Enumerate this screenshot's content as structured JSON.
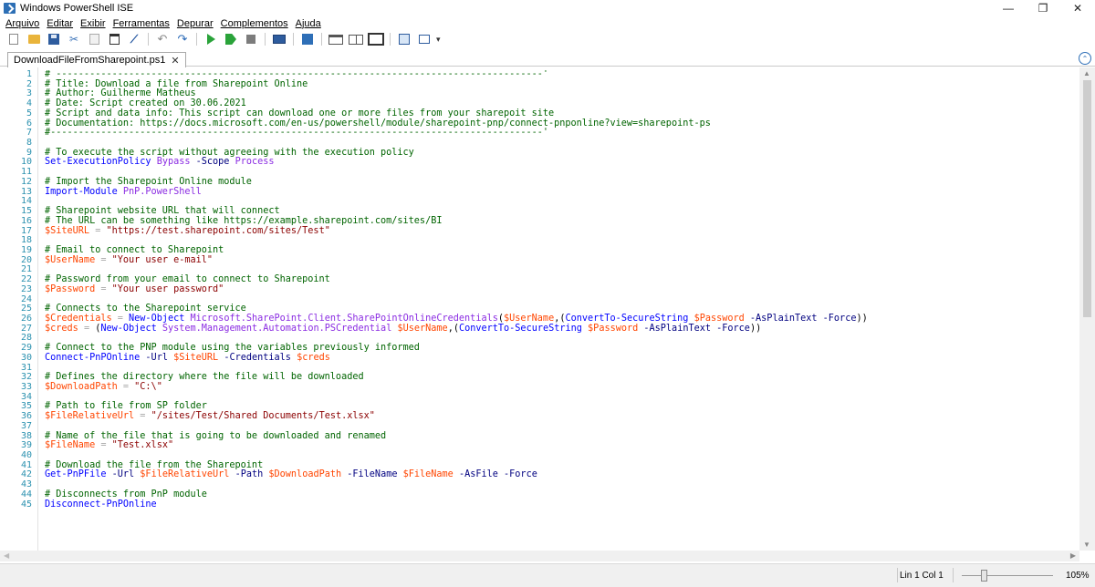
{
  "window": {
    "title": "Windows PowerShell ISE"
  },
  "menu": [
    "Arquivo",
    "Editar",
    "Exibir",
    "Ferramentas",
    "Depurar",
    "Complementos",
    "Ajuda"
  ],
  "tab": {
    "label": "DownloadFileFromSharepoint.ps1"
  },
  "editor": {
    "lines": [
      [
        [
          "c-comment",
          "# ---------------------------------------------------------------------------------------'"
        ]
      ],
      [
        [
          "c-comment",
          "# Title: Download a file from Sharepoint Online"
        ]
      ],
      [
        [
          "c-comment",
          "# Author: Guilherme Matheus"
        ]
      ],
      [
        [
          "c-comment",
          "# Date: Script created on 30.06.2021"
        ]
      ],
      [
        [
          "c-comment",
          "# Script and data info: This script can download one or more files from your sharepoit site"
        ]
      ],
      [
        [
          "c-comment",
          "# Documentation: https://docs.microsoft.com/en-us/powershell/module/sharepoint-pnp/connect-pnponline?view=sharepoint-ps"
        ]
      ],
      [
        [
          "c-comment",
          "#----------------------------------------------------------------------------------------'"
        ]
      ],
      [],
      [
        [
          "c-comment",
          "# To execute the script without agreeing with the execution policy"
        ]
      ],
      [
        [
          "c-cmd",
          "Set-ExecutionPolicy"
        ],
        [
          "c-grp",
          " "
        ],
        [
          "c-arg",
          "Bypass"
        ],
        [
          "c-grp",
          " "
        ],
        [
          "c-param",
          "-Scope"
        ],
        [
          "c-grp",
          " "
        ],
        [
          "c-arg",
          "Process"
        ]
      ],
      [],
      [
        [
          "c-comment",
          "# Import the Sharepoint Online module"
        ]
      ],
      [
        [
          "c-cmd",
          "Import-Module"
        ],
        [
          "c-grp",
          " "
        ],
        [
          "c-arg",
          "PnP.PowerShell"
        ]
      ],
      [],
      [
        [
          "c-comment",
          "# Sharepoint website URL that will connect"
        ]
      ],
      [
        [
          "c-comment",
          "# The URL can be something like https://example.sharepoint.com/sites/BI"
        ]
      ],
      [
        [
          "c-var",
          "$SiteURL"
        ],
        [
          "c-grp",
          " "
        ],
        [
          "c-op",
          "="
        ],
        [
          "c-grp",
          " "
        ],
        [
          "c-str",
          "\"https://test.sharepoint.com/sites/Test\""
        ]
      ],
      [],
      [
        [
          "c-comment",
          "# Email to connect to Sharepoint"
        ]
      ],
      [
        [
          "c-var",
          "$UserName"
        ],
        [
          "c-grp",
          " "
        ],
        [
          "c-op",
          "="
        ],
        [
          "c-grp",
          " "
        ],
        [
          "c-str",
          "\"Your user e-mail\""
        ]
      ],
      [],
      [
        [
          "c-comment",
          "# Password from your email to connect to Sharepoint"
        ]
      ],
      [
        [
          "c-var",
          "$Password"
        ],
        [
          "c-grp",
          " "
        ],
        [
          "c-op",
          "="
        ],
        [
          "c-grp",
          " "
        ],
        [
          "c-str",
          "\"Your user password\""
        ]
      ],
      [],
      [
        [
          "c-comment",
          "# Connects to the Sharepoint service"
        ]
      ],
      [
        [
          "c-var",
          "$Credentials"
        ],
        [
          "c-grp",
          " "
        ],
        [
          "c-op",
          "="
        ],
        [
          "c-grp",
          " "
        ],
        [
          "c-cmd",
          "New-Object"
        ],
        [
          "c-grp",
          " "
        ],
        [
          "c-arg",
          "Microsoft.SharePoint.Client.SharePointOnlineCredentials"
        ],
        [
          "c-grp",
          "("
        ],
        [
          "c-var",
          "$UserName"
        ],
        [
          "c-grp",
          ",("
        ],
        [
          "c-cmd",
          "ConvertTo-SecureString"
        ],
        [
          "c-grp",
          " "
        ],
        [
          "c-var",
          "$Password"
        ],
        [
          "c-grp",
          " "
        ],
        [
          "c-param",
          "-AsPlainText"
        ],
        [
          "c-grp",
          " "
        ],
        [
          "c-param",
          "-Force"
        ],
        [
          "c-grp",
          "))"
        ]
      ],
      [
        [
          "c-var",
          "$creds"
        ],
        [
          "c-grp",
          " "
        ],
        [
          "c-op",
          "="
        ],
        [
          "c-grp",
          " ("
        ],
        [
          "c-cmd",
          "New-Object"
        ],
        [
          "c-grp",
          " "
        ],
        [
          "c-arg",
          "System.Management.Automation.PSCredential"
        ],
        [
          "c-grp",
          " "
        ],
        [
          "c-var",
          "$UserName"
        ],
        [
          "c-grp",
          ",("
        ],
        [
          "c-cmd",
          "ConvertTo-SecureString"
        ],
        [
          "c-grp",
          " "
        ],
        [
          "c-var",
          "$Password"
        ],
        [
          "c-grp",
          " "
        ],
        [
          "c-param",
          "-AsPlainText"
        ],
        [
          "c-grp",
          " "
        ],
        [
          "c-param",
          "-Force"
        ],
        [
          "c-grp",
          "))"
        ]
      ],
      [],
      [
        [
          "c-comment",
          "# Connect to the PNP module using the variables previously informed"
        ]
      ],
      [
        [
          "c-cmd",
          "Connect-PnPOnline"
        ],
        [
          "c-grp",
          " "
        ],
        [
          "c-param",
          "-Url"
        ],
        [
          "c-grp",
          " "
        ],
        [
          "c-var",
          "$SiteURL"
        ],
        [
          "c-grp",
          " "
        ],
        [
          "c-param",
          "-Credentials"
        ],
        [
          "c-grp",
          " "
        ],
        [
          "c-var",
          "$creds"
        ]
      ],
      [],
      [
        [
          "c-comment",
          "# Defines the directory where the file will be downloaded"
        ]
      ],
      [
        [
          "c-var",
          "$DownloadPath"
        ],
        [
          "c-grp",
          " "
        ],
        [
          "c-op",
          "="
        ],
        [
          "c-grp",
          " "
        ],
        [
          "c-str",
          "\"C:\\\""
        ]
      ],
      [],
      [
        [
          "c-comment",
          "# Path to file from SP folder"
        ]
      ],
      [
        [
          "c-var",
          "$FileRelativeUrl"
        ],
        [
          "c-grp",
          " "
        ],
        [
          "c-op",
          "="
        ],
        [
          "c-grp",
          " "
        ],
        [
          "c-str",
          "\"/sites/Test/Shared Documents/Test.xlsx\""
        ]
      ],
      [],
      [
        [
          "c-comment",
          "# Name of the file that is going to be downloaded and renamed"
        ]
      ],
      [
        [
          "c-var",
          "$FileName"
        ],
        [
          "c-grp",
          " "
        ],
        [
          "c-op",
          "="
        ],
        [
          "c-grp",
          " "
        ],
        [
          "c-str",
          "\"Test.xlsx\""
        ]
      ],
      [],
      [
        [
          "c-comment",
          "# Download the file from the Sharepoint"
        ]
      ],
      [
        [
          "c-cmd",
          "Get-PnPFile"
        ],
        [
          "c-grp",
          " "
        ],
        [
          "c-param",
          "-Url"
        ],
        [
          "c-grp",
          " "
        ],
        [
          "c-var",
          "$FileRelativeUrl"
        ],
        [
          "c-grp",
          " "
        ],
        [
          "c-param",
          "-Path"
        ],
        [
          "c-grp",
          " "
        ],
        [
          "c-var",
          "$DownloadPath"
        ],
        [
          "c-grp",
          " "
        ],
        [
          "c-param",
          "-FileName"
        ],
        [
          "c-grp",
          " "
        ],
        [
          "c-var",
          "$FileName"
        ],
        [
          "c-grp",
          " "
        ],
        [
          "c-param",
          "-AsFile"
        ],
        [
          "c-grp",
          " "
        ],
        [
          "c-param",
          "-Force"
        ]
      ],
      [],
      [
        [
          "c-comment",
          "# Disconnects from PnP module"
        ]
      ],
      [
        [
          "c-cmd",
          "Disconnect-PnPOnline"
        ]
      ]
    ]
  },
  "status": {
    "position": "Lin 1  Col 1",
    "zoom": "105%",
    "zoom_level": 0.25
  }
}
